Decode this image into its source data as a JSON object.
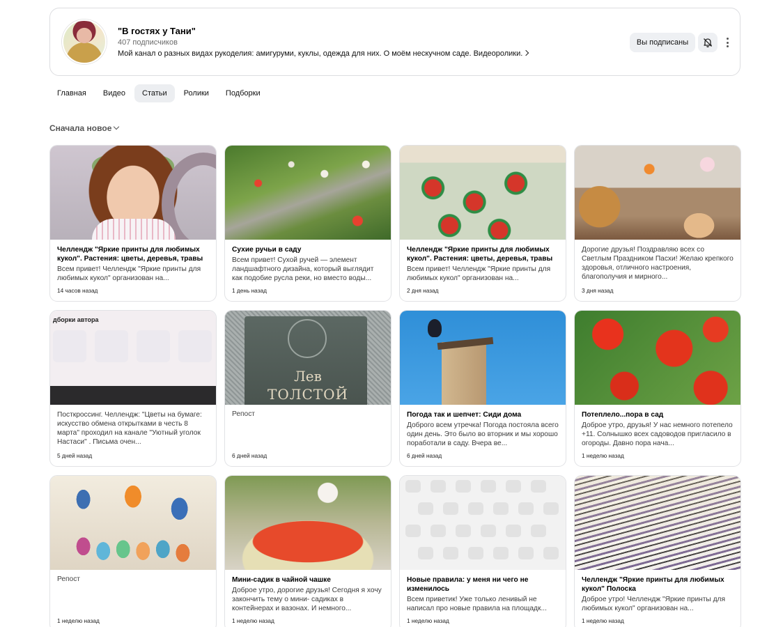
{
  "channel": {
    "title": "\"В гостях у Тани\"",
    "subscribers": "407 подписчиков",
    "description": "Мой канал о разных видах рукоделия: амигуруми, куклы, одежда для них. О моём нескучном саде. Видеоролики.",
    "subscribe_label": "Вы подписаны"
  },
  "tabs": [
    {
      "label": "Главная"
    },
    {
      "label": "Видео"
    },
    {
      "label": "Статьи",
      "active": true
    },
    {
      "label": "Ролики"
    },
    {
      "label": "Подборки"
    }
  ],
  "sort": {
    "label": "Сначала новое"
  },
  "cards": [
    {
      "title": "Челлендж \"Яркие принты для любимых кукол\". Растения: цветы, деревья, травы",
      "excerpt": "Всем привет! Челлендж \"Яркие принты для любимых кукол\" организован на...",
      "date": "14 часов назад"
    },
    {
      "title": "Сухие ручьи в саду",
      "excerpt": "Всем привет! Сухой ручей — элемент ландшафтного дизайна, который выглядит как подобие русла реки, но вместо воды...",
      "date": "1 день назад"
    },
    {
      "title": "Челлендж \"Яркие принты для любимых кукол\". Растения: цветы, деревья, травы",
      "excerpt": "Всем привет! Челлендж \"Яркие принты для любимых кукол\" организован на...",
      "date": "2 дня назад"
    },
    {
      "title": "",
      "excerpt": "Дорогие друзья! Поздравляю всех со Светлым Праздником Пасхи! Желаю крепкого здоровья, отличного настроения, благополучия и мирного...",
      "date": "3 дня назад"
    },
    {
      "title": "",
      "excerpt": "Посткроссинг. Челлендж: \"Цветы на бумаге: искусство обмена открытками в честь 8 марта\" проходил на канале \"Уютный уголок Настаси\" . Письма очен...",
      "date": "5 дней назад"
    },
    {
      "title": "",
      "repost": "Репост",
      "excerpt": "",
      "date": "6 дней назад"
    },
    {
      "title": "Погода так и шепчет: Сиди дома",
      "excerpt": "Доброго всем утречка! Погода постояла всего один день. Это было во вторник и мы хорошо поработали в саду. Вчера ве...",
      "date": "6 дней назад"
    },
    {
      "title": "Потеплело...пора в сад",
      "excerpt": "Доброе утро, друзья! У нас немного потепело +11. Солнышко всех садоводов пригласило в огороды. Давно пора нача...",
      "date": "1 неделю назад"
    },
    {
      "title": "",
      "repost": "Репост",
      "excerpt": "",
      "date": "1 неделю назад"
    },
    {
      "title": "Мини-садик в чайной чашке",
      "excerpt": "Доброе утро, дорогие друзья! Сегодня я хочу закончить тему о мини- садиках в контейнерах и вазонах. И немного...",
      "date": "1 неделю назад"
    },
    {
      "title": "Новые правила: у меня ни чего не изменилось",
      "excerpt": "Всем приветик! Уже только ленивый не написал про новые правила на площадк...",
      "date": "1 неделю назад"
    },
    {
      "title": "Челлендж \"Яркие принты для любимых кукол\" Полоска",
      "excerpt": "Доброе утро! Челлендж \"Яркие принты для любимых кукол\" организован на...",
      "date": "1 неделю назад"
    }
  ],
  "thumb_texts": {
    "screen_label": "дборки автора",
    "book_line1": "Лев",
    "book_line2": "ТОЛСТОЙ"
  },
  "icons": {
    "bell": "bell-off-icon",
    "more": "more-vertical-icon",
    "chevron": "chevron-right-icon",
    "sort_chevron": "chevron-down-icon"
  }
}
